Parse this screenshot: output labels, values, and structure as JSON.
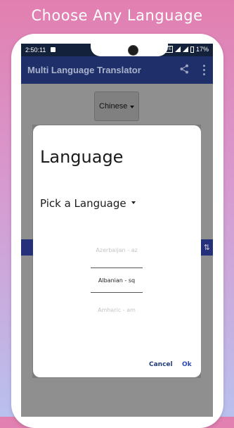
{
  "headline": "Choose Any Language",
  "status_bar": {
    "time": "2:50:11",
    "network": "VoLTE",
    "battery": "17%"
  },
  "app_bar": {
    "title": "Multi Language Translator",
    "share_icon": "share-icon",
    "more_icon": "more-vert-icon"
  },
  "source_language": {
    "selected": "Chinese"
  },
  "dialog": {
    "title": "Language",
    "subtitle": "Pick a Language",
    "picker": {
      "previous": "Azerbaijan - az",
      "current": "Albanian - sq",
      "next": "Amharic - am"
    },
    "cancel_label": "Cancel",
    "ok_label": "Ok"
  },
  "colors": {
    "app_bar": "#1e2f6a",
    "accent": "#2948b8",
    "scrim": "#8f8f8f"
  }
}
